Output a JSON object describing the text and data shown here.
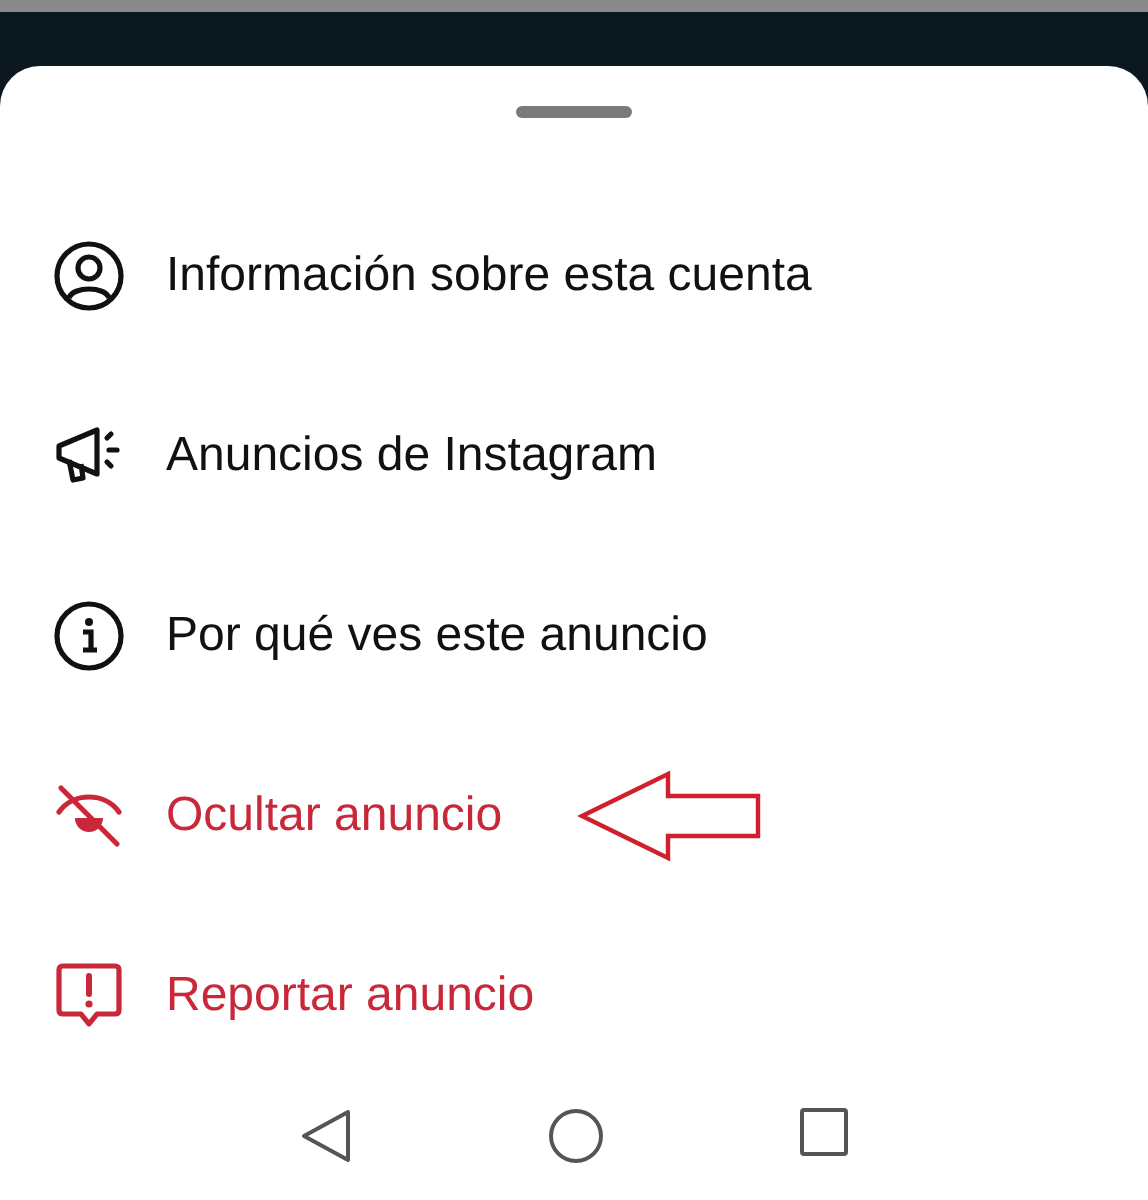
{
  "menu_items": [
    {
      "label": "Información sobre esta cuenta",
      "kind": "normal"
    },
    {
      "label": "Anuncios de Instagram",
      "kind": "normal"
    },
    {
      "label": "Por qué ves este anuncio",
      "kind": "normal"
    },
    {
      "label": "Ocultar anuncio",
      "kind": "danger",
      "highlighted": true
    },
    {
      "label": "Reportar anuncio",
      "kind": "danger"
    }
  ]
}
